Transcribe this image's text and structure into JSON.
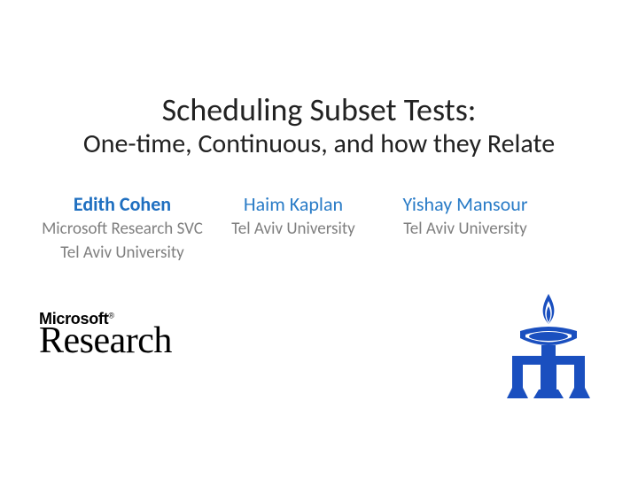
{
  "title": {
    "main": "Scheduling Subset Tests:",
    "sub": "One-time, Continuous, and how they Relate"
  },
  "authors": [
    {
      "name": "Edith Cohen",
      "affiliations": [
        "Microsoft Research SVC",
        "Tel Aviv University"
      ]
    },
    {
      "name": "Haim Kaplan",
      "affiliations": [
        "Tel Aviv University"
      ]
    },
    {
      "name": "Yishay Mansour",
      "affiliations": [
        "Tel Aviv University"
      ]
    }
  ],
  "logos": {
    "microsoft": {
      "word": "Microsoft",
      "reg": "®",
      "research": "Research"
    },
    "tau": {
      "name": "Tel Aviv University logo",
      "color": "#1a4fbf"
    }
  }
}
